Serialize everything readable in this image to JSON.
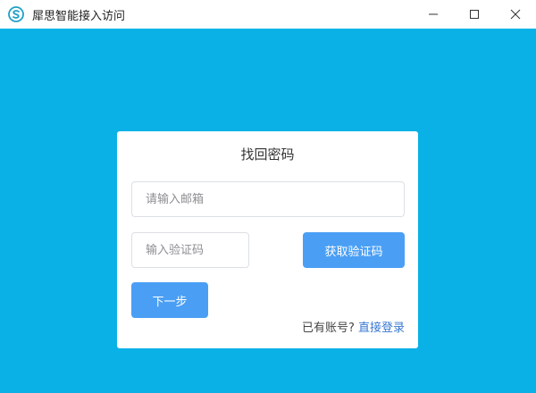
{
  "window": {
    "title": "犀思智能接入访问",
    "logo_icon": "s-logo-icon",
    "controls": {
      "minimize_icon": "minimize-icon",
      "maximize_icon": "maximize-icon",
      "close_icon": "close-icon"
    }
  },
  "colors": {
    "background": "#0ab1e6",
    "accent": "#4a9ff5",
    "link": "#3a78d2"
  },
  "form": {
    "title": "找回密码",
    "email": {
      "placeholder": "请输入邮箱",
      "value": ""
    },
    "code": {
      "placeholder": "输入验证码",
      "value": ""
    },
    "get_code_label": "获取验证码",
    "next_label": "下一步",
    "have_account_text": "已有账号?",
    "login_link_text": "直接登录"
  }
}
